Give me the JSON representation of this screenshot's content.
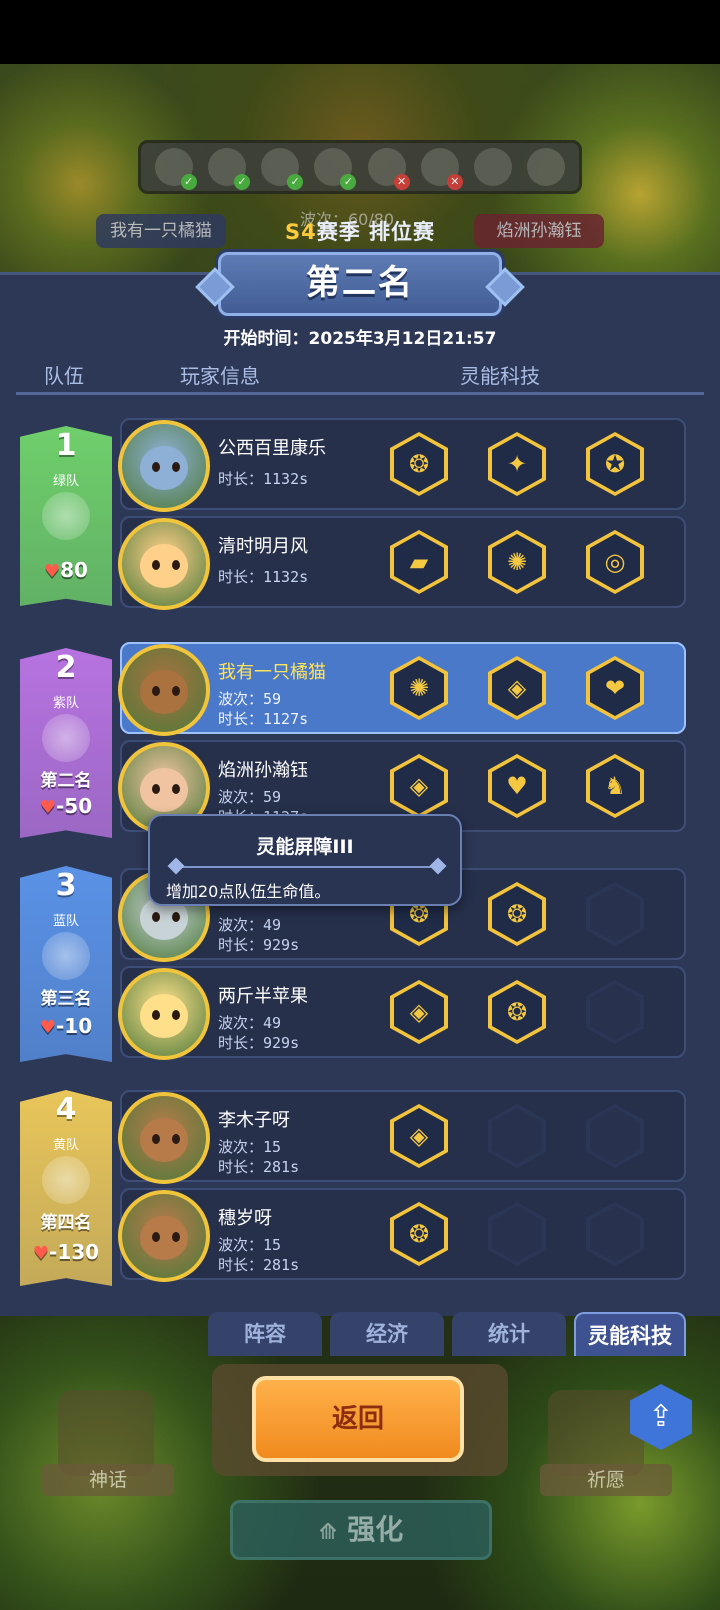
{
  "season": {
    "prefix": "S4",
    "label": "赛季 排位赛"
  },
  "rank_title": "第二名",
  "start_time": "开始时间：2025年3月12日21:57",
  "columns": {
    "team": "队伍",
    "player": "玩家信息",
    "tech": "灵能科技"
  },
  "background": {
    "left_name": "我有一只橘猫",
    "right_name": "焰洲孙瀚钰",
    "wave": "波次：60/80"
  },
  "teams": [
    {
      "num": "1",
      "name": "绿队",
      "rank": "",
      "hp": "80",
      "color": "#6fcf6a",
      "players": [
        {
          "name": "公西百里康乐",
          "wave": "",
          "time": "时长：1132s",
          "techs": [
            "❂",
            "✦",
            "✪"
          ]
        },
        {
          "name": "清时明月风",
          "wave": "",
          "time": "时长：1132s",
          "techs": [
            "▰",
            "✺",
            "◎"
          ]
        }
      ]
    },
    {
      "num": "2",
      "name": "紫队",
      "rank": "第二名",
      "hp": "-50",
      "color": "#b773e0",
      "players": [
        {
          "name": "我有一只橘猫",
          "wave": "波次：59",
          "time": "时长：1127s",
          "techs": [
            "✺",
            "◈",
            "❤"
          ]
        },
        {
          "name": "焰洲孙瀚钰",
          "wave": "波次：59",
          "time": "时长：1127s",
          "techs": [
            "◈",
            "♥",
            "♞"
          ]
        }
      ]
    },
    {
      "num": "3",
      "name": "蓝队",
      "rank": "第三名",
      "hp": "-10",
      "color": "#5a92e6",
      "players": [
        {
          "name": "",
          "wave": "波次：49",
          "time": "时长：929s",
          "techs": [
            "❂",
            "❂",
            ""
          ]
        },
        {
          "name": "两斤半苹果",
          "wave": "波次：49",
          "time": "时长：929s",
          "techs": [
            "◈",
            "❂",
            ""
          ]
        }
      ]
    },
    {
      "num": "4",
      "name": "黄队",
      "rank": "第四名",
      "hp": "-130",
      "color": "#e9c65a",
      "players": [
        {
          "name": "李木子呀",
          "wave": "波次：15",
          "time": "时长：281s",
          "techs": [
            "◈",
            "",
            ""
          ]
        },
        {
          "name": "穗岁呀",
          "wave": "波次：15",
          "time": "时长：281s",
          "techs": [
            "❂",
            "",
            ""
          ]
        }
      ]
    }
  ],
  "tooltip": {
    "title": "灵能屏障III",
    "desc": "增加20点队伍生命值。"
  },
  "tabs": [
    "阵容",
    "经济",
    "统计",
    "灵能科技"
  ],
  "active_tab": "灵能科技",
  "buttons": {
    "back": "返回",
    "upgrade": "强化",
    "myth": "神话",
    "wish": "祈愿",
    "share_icon": "share-icon"
  }
}
